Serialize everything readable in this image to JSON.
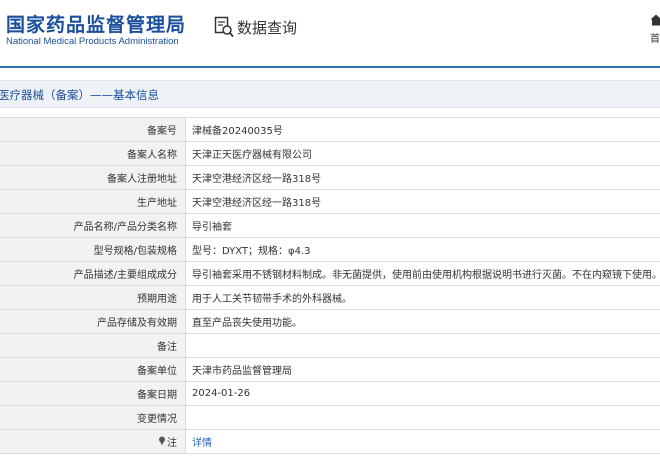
{
  "header": {
    "agency_cn": "国家药品监督管理局",
    "agency_en": "National Medical Products Administration",
    "query_label": "数据查询",
    "home_label": "首页"
  },
  "icons": {
    "query": "magnifier-document-icon",
    "home": "home-icon",
    "note": "pin-icon"
  },
  "colors": {
    "brand": "#1b4f9c",
    "link": "#2a64b8",
    "label_bg": "#f2f2f2",
    "section_bg": "#eef1f5"
  },
  "section": {
    "title": "医疗器械（备案）——基本信息"
  },
  "rows": [
    {
      "label": "备案号",
      "value": "津械备20240035号"
    },
    {
      "label": "备案人名称",
      "value": "天津正天医疗器械有限公司"
    },
    {
      "label": "备案人注册地址",
      "value": "天津空港经济区经一路318号"
    },
    {
      "label": "生产地址",
      "value": "天津空港经济区经一路318号"
    },
    {
      "label": "产品名称/产品分类名称",
      "value": "导引袖套"
    },
    {
      "label": "型号规格/包装规格",
      "value": "型号：DYXT；规格：φ4.3"
    },
    {
      "label": "产品描述/主要组成成分",
      "value": "导引袖套采用不锈钢材料制成。非无菌提供，使用前由使用机构根据说明书进行灭菌。不在内窥镜下使用。"
    },
    {
      "label": "预期用途",
      "value": "用于人工关节韧带手术的外科器械。"
    },
    {
      "label": "产品存储及有效期",
      "value": "直至产品丧失使用功能。"
    },
    {
      "label": "备注",
      "value": ""
    },
    {
      "label": "备案单位",
      "value": "天津市药品监督管理局"
    },
    {
      "label": "备案日期",
      "value": "2024-01-26"
    },
    {
      "label": "变更情况",
      "value": ""
    }
  ],
  "note_row": {
    "label": "注",
    "link": "详情"
  }
}
